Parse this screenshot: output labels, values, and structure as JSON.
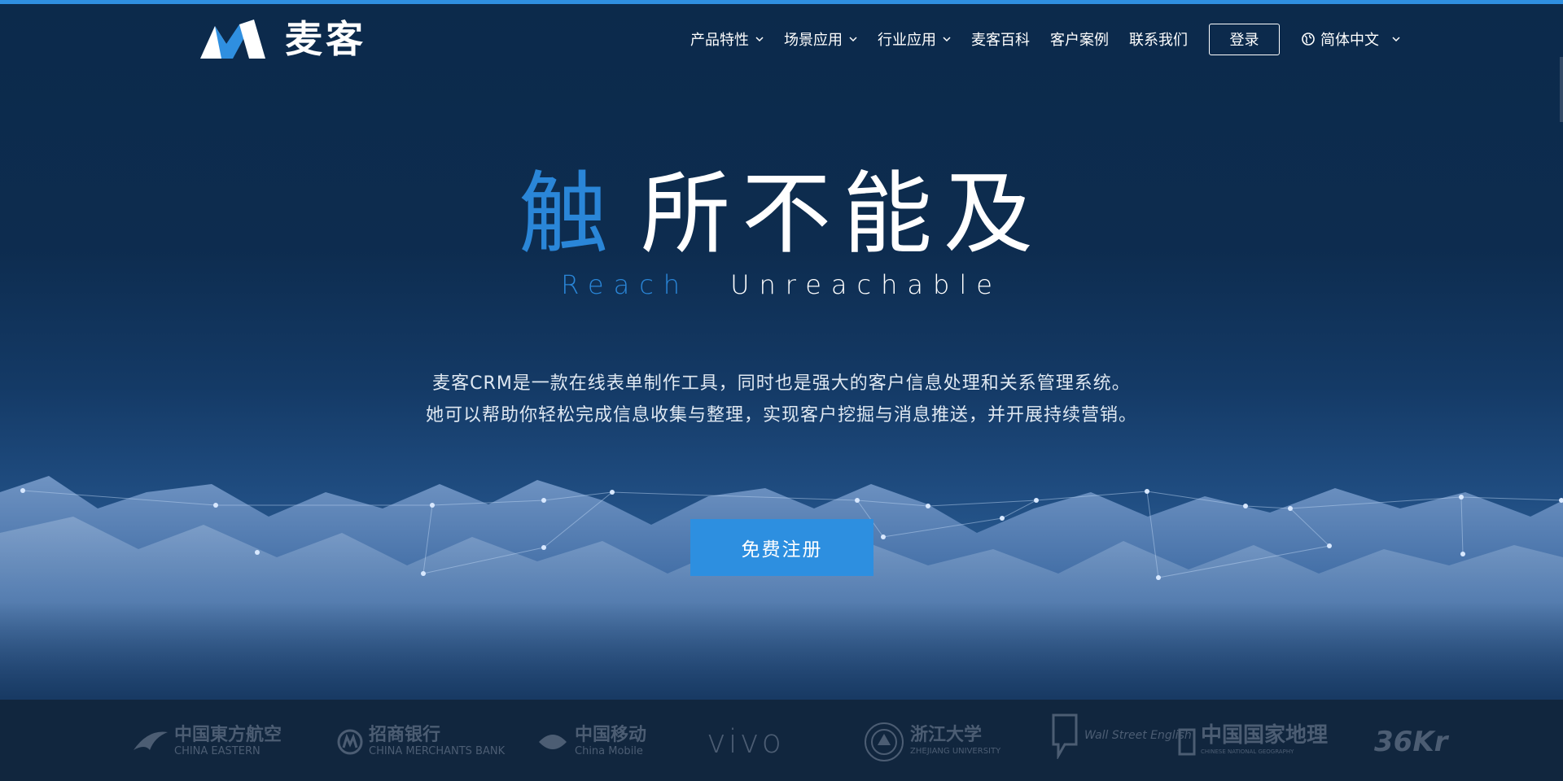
{
  "brand": {
    "name": "麦客",
    "accent_color": "#2f8fe0",
    "logo_icon": "maike-m-logo"
  },
  "nav": {
    "items": [
      {
        "label": "产品特性",
        "has_dropdown": true
      },
      {
        "label": "场景应用",
        "has_dropdown": true
      },
      {
        "label": "行业应用",
        "has_dropdown": true
      },
      {
        "label": "麦客百科",
        "has_dropdown": false
      },
      {
        "label": "客户案例",
        "has_dropdown": false
      },
      {
        "label": "联系我们",
        "has_dropdown": false
      }
    ],
    "login_label": "登录",
    "language": {
      "label": "简体中文",
      "icon": "globe-icon"
    }
  },
  "hero": {
    "headline_accent": "触",
    "headline_rest": "所不能及",
    "subline_accent": "Reach",
    "subline_rest": "Unreachable",
    "description_line1": "麦客CRM是一款在线表单制作工具，同时也是强大的客户信息处理和关系管理系统。",
    "description_line2": "她可以帮助你轻松完成信息收集与整理，实现客户挖掘与消息推送，并开展持续营销。",
    "cta_label": "免费注册",
    "accent_text_color": "#2a86d8",
    "cta_color": "#2d8fe0"
  },
  "partners": [
    {
      "name_cn": "中国東方航空",
      "name_en": "CHINA EASTERN",
      "icon": "china-eastern-logo-icon"
    },
    {
      "name_cn": "招商银行",
      "name_en": "CHINA MERCHANTS BANK",
      "icon": "cmb-logo-icon"
    },
    {
      "name_cn": "中国移动",
      "name_en": "China Mobile",
      "icon": "china-mobile-logo-icon"
    },
    {
      "name_cn": "vivo",
      "name_en": "",
      "icon": "vivo-logo-icon"
    },
    {
      "name_cn": "浙江大学",
      "name_en": "ZHEJIANG UNIVERSITY",
      "icon": "zju-seal-icon"
    },
    {
      "name_cn": "Wall Street English",
      "name_en": "",
      "icon": "wall-street-english-logo-icon"
    },
    {
      "name_cn": "中国国家地理",
      "name_en": "CHINESE NATIONAL GEOGRAPHY",
      "icon": "cng-logo-icon"
    },
    {
      "name_cn": "36Kr",
      "name_en": "",
      "icon": "36kr-logo-icon"
    }
  ]
}
